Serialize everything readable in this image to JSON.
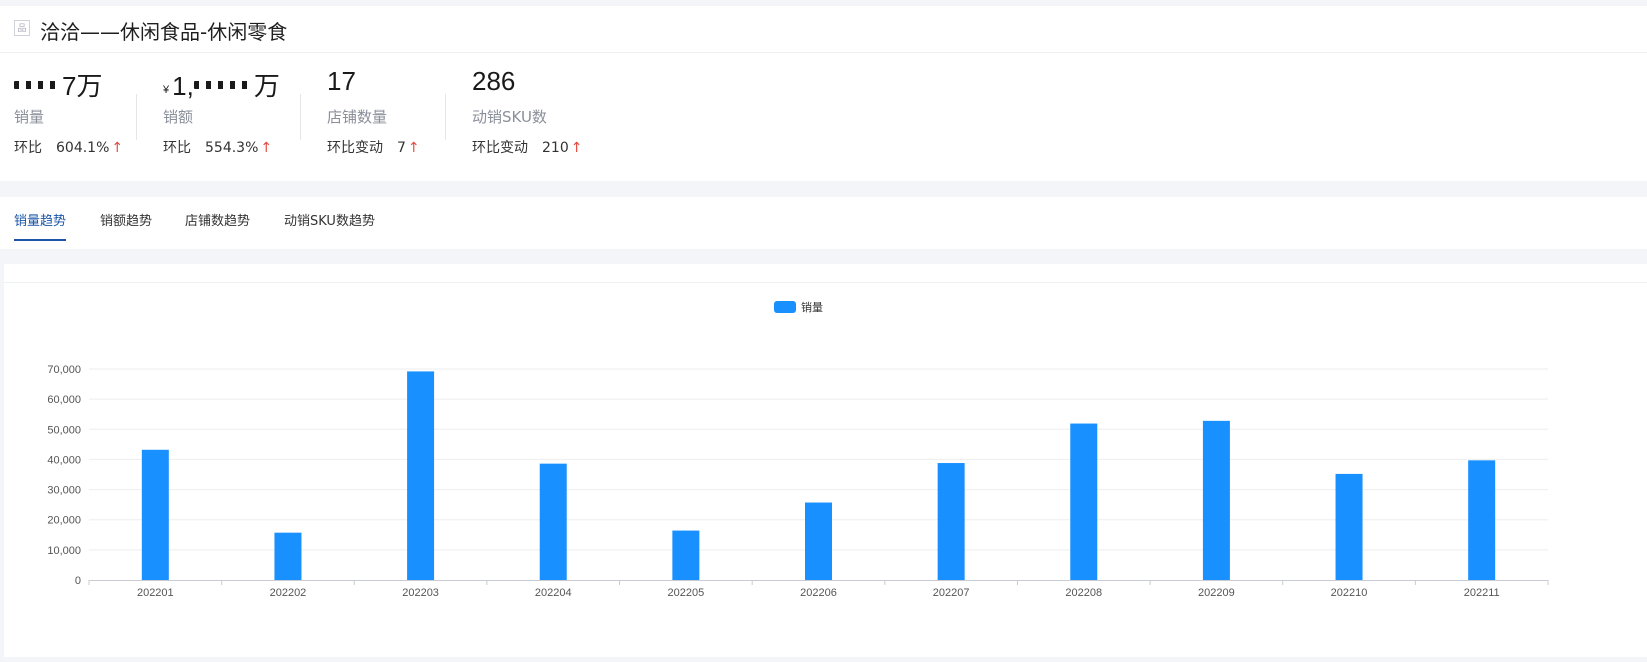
{
  "header": {
    "icon": "shop-icon",
    "title": "洽洽——休闲食品-休闲零食"
  },
  "metrics": [
    {
      "value_suffix": "7万",
      "label": "销量",
      "compare_label": "环比",
      "compare_value": "604.1%",
      "arrow": "↑"
    },
    {
      "prefix": "¥",
      "value_start": "1,",
      "value_suffix": "万",
      "label": "销额",
      "compare_label": "环比",
      "compare_value": "554.3%",
      "arrow": "↑"
    },
    {
      "value": "17",
      "label": "店铺数量",
      "compare_label": "环比变动",
      "compare_value": "7",
      "arrow": "↑"
    },
    {
      "value": "286",
      "label": "动销SKU数",
      "compare_label": "环比变动",
      "compare_value": "210",
      "arrow": "↑"
    }
  ],
  "tabs": [
    {
      "label": "销量趋势",
      "active": true
    },
    {
      "label": "销额趋势",
      "active": false
    },
    {
      "label": "店铺数趋势",
      "active": false
    },
    {
      "label": "动销SKU数趋势",
      "active": false
    }
  ],
  "colors": {
    "accent": "#1a56a8",
    "bar": "#1890ff",
    "up_arrow": "#e5483f"
  },
  "chart_data": {
    "type": "bar",
    "legend": [
      "销量"
    ],
    "legend_position": "top-center",
    "categories": [
      "202201",
      "202202",
      "202203",
      "202204",
      "202205",
      "202206",
      "202207",
      "202208",
      "202209",
      "202210",
      "202211"
    ],
    "series": [
      {
        "name": "销量",
        "values": [
          43200,
          15700,
          69200,
          38600,
          16400,
          25700,
          38800,
          51900,
          52800,
          35200,
          39700
        ]
      }
    ],
    "yticks": [
      "0",
      "10,000",
      "20,000",
      "30,000",
      "40,000",
      "50,000",
      "60,000",
      "70,000"
    ],
    "ylim": [
      0,
      70000
    ],
    "grid": true
  }
}
